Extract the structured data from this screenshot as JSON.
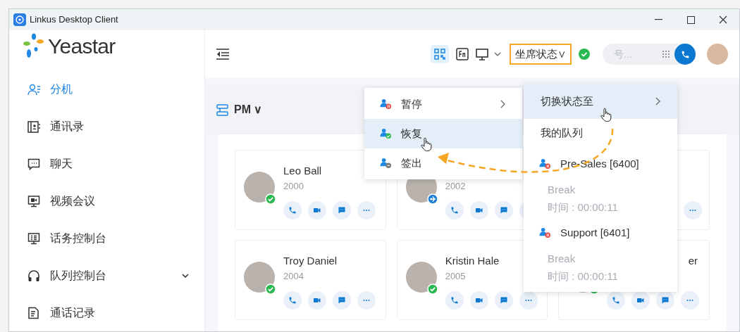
{
  "window": {
    "title": "Linkus Desktop Client"
  },
  "sidebar": {
    "logo": "Yeastar",
    "items": [
      {
        "label": "分机",
        "selected": true,
        "expandable": false
      },
      {
        "label": "通讯录",
        "selected": false,
        "expandable": false
      },
      {
        "label": "聊天",
        "selected": false,
        "expandable": false
      },
      {
        "label": "视频会议",
        "selected": false,
        "expandable": false
      },
      {
        "label": "话务控制台",
        "selected": false,
        "expandable": false
      },
      {
        "label": "队列控制台",
        "selected": false,
        "expandable": true
      },
      {
        "label": "通话记录",
        "selected": false,
        "expandable": false
      }
    ]
  },
  "toolbar": {
    "agent_status": "坐席状态",
    "agent_status_caret": "∨",
    "dial_placeholder": "号..."
  },
  "group": {
    "name": "PM",
    "caret": "∨"
  },
  "cards": [
    {
      "name": "Leo Ball",
      "extension": "2000",
      "kind": "available"
    },
    {
      "extension": "2002",
      "kind": "away"
    },
    {
      "kind": "covered"
    },
    {
      "name": "Troy Daniel",
      "extension": "2004",
      "kind": "available"
    },
    {
      "name": "Kristin Hale",
      "extension": "2005",
      "kind": "available"
    },
    {
      "name": "er",
      "kind": "available"
    }
  ],
  "status_menu": {
    "items": [
      {
        "label": "暂停",
        "kind": "paused",
        "selected": false,
        "submenu": true
      },
      {
        "label": "恢复",
        "kind": "resumed",
        "selected": true,
        "submenu": false
      },
      {
        "label": "签出",
        "kind": "logged_out",
        "selected": false,
        "submenu": false
      }
    ]
  },
  "queue_menu": {
    "switch_to": {
      "label": "切换状态至",
      "selected": true
    },
    "heading": "我的队列",
    "queues": [
      {
        "name": "Pre-Sales [6400]",
        "status": "Break",
        "time": "时间 : 00:00:11"
      },
      {
        "name": "Support [6401]",
        "status": "Break",
        "time": "时间 : 00:00:11"
      }
    ]
  }
}
